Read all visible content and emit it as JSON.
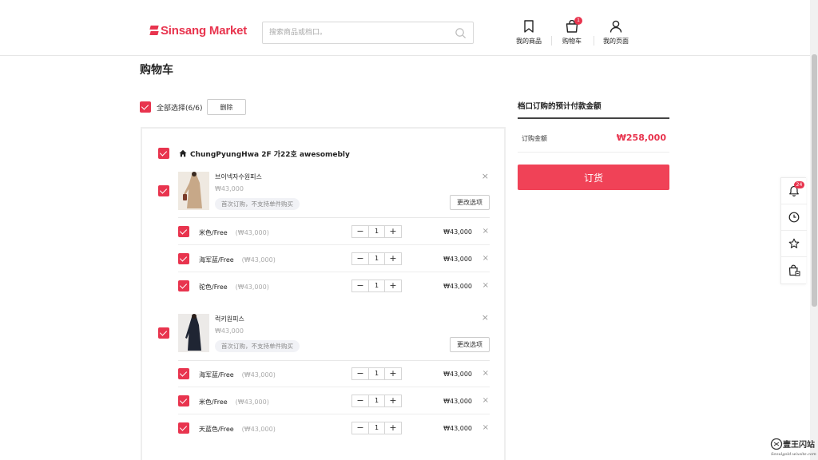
{
  "header": {
    "logo_text": "Sinsang Market",
    "search_placeholder": "搜索商品或档口。",
    "nav": [
      {
        "label": "我的商品",
        "icon": "bookmark-icon"
      },
      {
        "label": "购物车",
        "icon": "shopping-bag-icon",
        "badge": "1"
      },
      {
        "label": "我的页面",
        "icon": "user-icon"
      }
    ]
  },
  "page_title": "购物车",
  "select_all": {
    "label": "全部选择(6/6)",
    "delete_label": "删除"
  },
  "store": {
    "name": "ChungPyungHwa 2F 가22호 awesomebly"
  },
  "products": [
    {
      "name": "브이넥자수원피스",
      "price": "₩43,000",
      "tag": "首次订购，不支持单件购买",
      "change_label": "更改选项",
      "options": [
        {
          "name": "米色/Free",
          "unit": "(₩43,000)",
          "qty": "1",
          "price": "₩43,000"
        },
        {
          "name": "海军蓝/Free",
          "unit": "(₩43,000)",
          "qty": "1",
          "price": "₩43,000"
        },
        {
          "name": "驼色/Free",
          "unit": "(₩43,000)",
          "qty": "1",
          "price": "₩43,000"
        }
      ]
    },
    {
      "name": "럭키원피스",
      "price": "₩43,000",
      "tag": "首次订购，不支持单件购买",
      "change_label": "更改选项",
      "options": [
        {
          "name": "海军蓝/Free",
          "unit": "(₩43,000)",
          "qty": "1",
          "price": "₩43,000"
        },
        {
          "name": "米色/Free",
          "unit": "(₩43,000)",
          "qty": "1",
          "price": "₩43,000"
        },
        {
          "name": "天蓝色/Free",
          "unit": "(₩43,000)",
          "qty": "1",
          "price": "₩43,000"
        }
      ]
    }
  ],
  "summary": {
    "title": "档口订购的预计付款金额",
    "amount_label": "订购金额",
    "amount_value": "₩258,000",
    "order_label": "订货"
  },
  "side_bar": {
    "notification_badge": "24"
  },
  "watermark": {
    "text": "壹王闪站",
    "sub": "Seoulgold.wixsite.com"
  },
  "colors": {
    "accent": "#e8344e",
    "button": "#f04257"
  }
}
